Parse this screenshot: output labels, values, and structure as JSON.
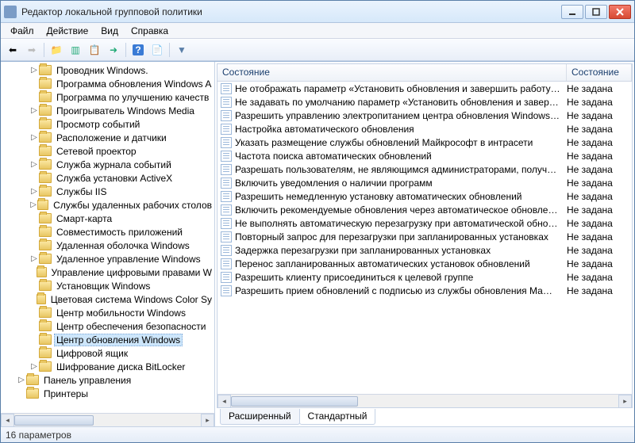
{
  "window": {
    "title": "Редактор локальной групповой политики"
  },
  "menu": {
    "file": "Файл",
    "action": "Действие",
    "view": "Вид",
    "help": "Справка"
  },
  "tree": {
    "items": [
      {
        "label": "Проводник Windows.",
        "indent": 2,
        "expander": "▷"
      },
      {
        "label": "Программа обновления Windows A",
        "indent": 2,
        "expander": ""
      },
      {
        "label": "Программа по улучшению качеств",
        "indent": 2,
        "expander": ""
      },
      {
        "label": "Проигрыватель Windows Media",
        "indent": 2,
        "expander": "▷"
      },
      {
        "label": "Просмотр событий",
        "indent": 2,
        "expander": ""
      },
      {
        "label": "Расположение и датчики",
        "indent": 2,
        "expander": "▷"
      },
      {
        "label": "Сетевой проектор",
        "indent": 2,
        "expander": ""
      },
      {
        "label": "Служба журнала событий",
        "indent": 2,
        "expander": "▷"
      },
      {
        "label": "Служба установки ActiveX",
        "indent": 2,
        "expander": ""
      },
      {
        "label": "Службы IIS",
        "indent": 2,
        "expander": "▷"
      },
      {
        "label": "Службы удаленных рабочих столов",
        "indent": 2,
        "expander": "▷"
      },
      {
        "label": "Смарт-карта",
        "indent": 2,
        "expander": ""
      },
      {
        "label": "Совместимость приложений",
        "indent": 2,
        "expander": ""
      },
      {
        "label": "Удаленная оболочка Windows",
        "indent": 2,
        "expander": ""
      },
      {
        "label": "Удаленное управление Windows",
        "indent": 2,
        "expander": "▷"
      },
      {
        "label": "Управление цифровыми правами W",
        "indent": 2,
        "expander": ""
      },
      {
        "label": "Установщик Windows",
        "indent": 2,
        "expander": ""
      },
      {
        "label": "Цветовая система Windows Color Sy",
        "indent": 2,
        "expander": ""
      },
      {
        "label": "Центр мобильности Windows",
        "indent": 2,
        "expander": ""
      },
      {
        "label": "Центр обеспечения безопасности",
        "indent": 2,
        "expander": ""
      },
      {
        "label": "Центр обновления Windows",
        "indent": 2,
        "expander": "",
        "selected": true
      },
      {
        "label": "Цифровой ящик",
        "indent": 2,
        "expander": ""
      },
      {
        "label": "Шифрование диска BitLocker",
        "indent": 2,
        "expander": "▷"
      },
      {
        "label": "Панель управления",
        "indent": 1,
        "expander": "▷"
      },
      {
        "label": "Принтеры",
        "indent": 1,
        "expander": ""
      }
    ]
  },
  "list": {
    "columns": {
      "c1": "Состояние",
      "c2": "Состояние"
    },
    "rows": [
      {
        "name": "Не отображать параметр «Установить обновления и завершить работу…",
        "state": "Не задана"
      },
      {
        "name": "Не задавать по умолчанию параметр «Установить обновления и завер…",
        "state": "Не задана"
      },
      {
        "name": "Разрешить управлению электропитанием центра обновления Windows…",
        "state": "Не задана"
      },
      {
        "name": "Настройка автоматического обновления",
        "state": "Не задана"
      },
      {
        "name": "Указать размещение службы обновлений Майкрософт в интрасети",
        "state": "Не задана"
      },
      {
        "name": "Частота поиска автоматических обновлений",
        "state": "Не задана"
      },
      {
        "name": "Разрешать пользователям, не являющимся администраторами, получ…",
        "state": "Не задана"
      },
      {
        "name": "Включить уведомления о наличии программ",
        "state": "Не задана"
      },
      {
        "name": "Разрешить немедленную установку автоматических обновлений",
        "state": "Не задана"
      },
      {
        "name": "Включить рекомендуемые обновления через автоматическое обновле…",
        "state": "Не задана"
      },
      {
        "name": "Не выполнять автоматическую перезагрузку при автоматической обно…",
        "state": "Не задана"
      },
      {
        "name": "Повторный запрос для перезагрузки при запланированных установках",
        "state": "Не задана"
      },
      {
        "name": "Задержка перезагрузки при запланированных установках",
        "state": "Не задана"
      },
      {
        "name": "Перенос запланированных автоматических установок обновлений",
        "state": "Не задана"
      },
      {
        "name": "Разрешить клиенту присоединиться к целевой группе",
        "state": "Не задана"
      },
      {
        "name": "Разрешить прием обновлений с подписью из службы обновления Ма…",
        "state": "Не задана"
      }
    ]
  },
  "tabs": {
    "extended": "Расширенный",
    "standard": "Стандартный"
  },
  "status": {
    "text": "16 параметров"
  }
}
